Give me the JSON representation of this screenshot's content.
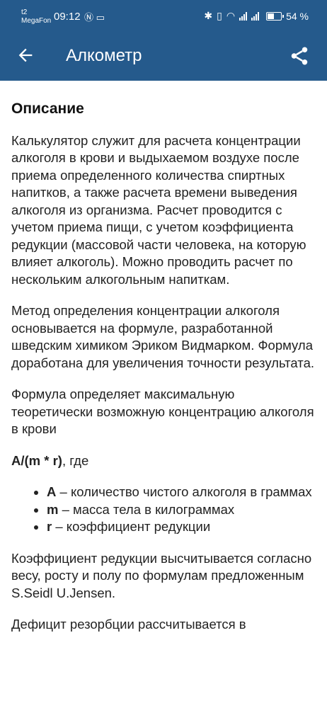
{
  "status": {
    "carrier_top": "t2",
    "carrier_name": "MegaFon",
    "time": "09:12",
    "battery": "54 %"
  },
  "appbar": {
    "title": "Алкометр"
  },
  "content": {
    "heading": "Описание",
    "p1": "Калькулятор служит для расчета концентрации алкоголя в крови и выдыхаемом воздухе после приема определенного количества спиртных напитков, а также расчета времени выведения алкоголя из организма. Расчет проводится с учетом приема пищи, с учетом коэффициента редукции (массовой части человека, на которую влияет алкоголь). Можно проводить расчет по нескольким алкогольным напиткам.",
    "p2": "Метод определения концентрации алкоголя основывается на формуле, разработанной шведским химиком Эриком Видмарком. Формула доработана для увеличения точности результата.",
    "p3": "Формула определяет максимальную теоретически возможную концентрацию алкоголя в крови",
    "formula_bold": "A/(m * r)",
    "formula_rest": ", где",
    "bullets": [
      {
        "term": "A",
        "desc": " – количество чистого алкоголя в граммах"
      },
      {
        "term": "m",
        "desc": " – масса тела в килограммах"
      },
      {
        "term": "r",
        "desc": " – коэффициент редукции"
      }
    ],
    "p4": "Коэффициент редукции высчитывается согласно весу, росту и полу по формулам предложенным S.Seidl U.Jensen.",
    "p5": "Дефицит резорбции рассчитывается в"
  }
}
